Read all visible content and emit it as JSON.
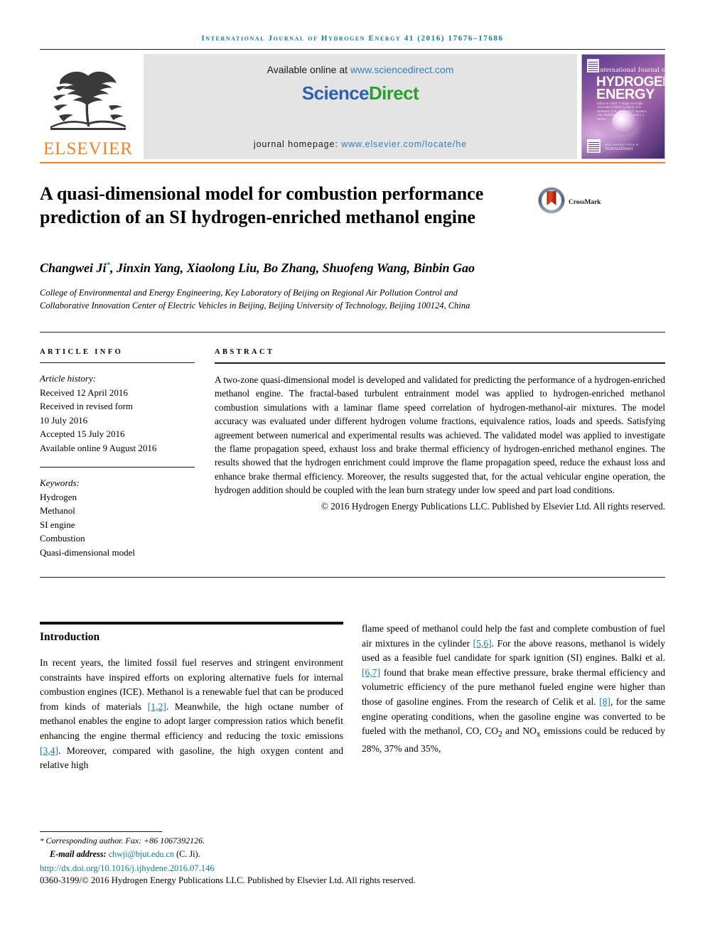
{
  "running_head": "International Journal of Hydrogen Energy 41 (2016) 17676–17686",
  "masthead": {
    "publisher_name": "ELSEVIER",
    "publisher_logo_icon": "elsevier-tree-icon",
    "available_prefix": "Available online at ",
    "available_url": "www.sciencedirect.com",
    "wordmark_first": "Science",
    "wordmark_second": "Direct",
    "homepage_prefix": "journal homepage: ",
    "homepage_url": "www.elsevier.com/locate/he",
    "cover": {
      "line1": "International Journal of",
      "line2": "HYDROGEN",
      "line3": "ENERGY",
      "editors": "Editor-in-Chief: T. Nejat Veziroğlu  Associate Editors: S. Dunn, R.C. Neuhaus, H.R. Alanis, R.C. Navarro, J.M. Bastidas, L.I. Zhu, J. and C.J. Winter",
      "bottom_brand": "ScienceDirect",
      "bottom_brand_small": "Now available online at"
    }
  },
  "article": {
    "title": "A quasi-dimensional model for combustion performance prediction of an SI hydrogen-enriched methanol engine",
    "crossmark_label": "CrossMark",
    "crossmark_icon": "crossmark-icon",
    "authors": "Changwei Ji*, Jinxin Yang, Xiaolong Liu, Bo Zhang, Shuofeng Wang, Binbin Gao",
    "authors_pre_star": "Changwei Ji",
    "authors_star": "*",
    "authors_post_star": ", Jinxin Yang, Xiaolong Liu, Bo Zhang, Shuofeng Wang, Binbin Gao",
    "affiliation": "College of Environmental and Energy Engineering, Key Laboratory of Beijing on Regional Air Pollution Control and Collaborative Innovation Center of Electric Vehicles in Beijing, Beijing University of Technology, Beijing 100124, China"
  },
  "article_info": {
    "heading": "ARTICLE INFO",
    "history_label": "Article history:",
    "history": [
      "Received 12 April 2016",
      "Received in revised form",
      "10 July 2016",
      "Accepted 15 July 2016",
      "Available online 9 August 2016"
    ],
    "keywords_label": "Keywords:",
    "keywords": [
      "Hydrogen",
      "Methanol",
      "SI engine",
      "Combustion",
      "Quasi-dimensional model"
    ]
  },
  "abstract": {
    "heading": "ABSTRACT",
    "text": "A two-zone quasi-dimensional model is developed and validated for predicting the performance of a hydrogen-enriched methanol engine. The fractal-based turbulent entrainment model was applied to hydrogen-enriched methanol combustion simulations with a laminar flame speed correlation of hydrogen-methanol-air mixtures. The model accuracy was evaluated under different hydrogen volume fractions, equivalence ratios, loads and speeds. Satisfying agreement between numerical and experimental results was achieved. The validated model was applied to investigate the flame propagation speed, exhaust loss and brake thermal efficiency of hydrogen-enriched methanol engines. The results showed that the hydrogen enrichment could improve the flame propagation speed, reduce the exhaust loss and enhance brake thermal efficiency. Moreover, the results suggested that, for the actual vehicular engine operation, the hydrogen addition should be coupled with the lean burn strategy under low speed and part load conditions.",
    "copyright": "© 2016 Hydrogen Energy Publications LLC. Published by Elsevier Ltd. All rights reserved."
  },
  "body": {
    "section_title": "Introduction",
    "left_paragraph_pre": "In recent years, the limited fossil fuel reserves and stringent environment constraints have inspired efforts on exploring alternative fuels for internal combustion engines (ICE). Methanol is a renewable fuel that can be produced from kinds of materials ",
    "ref_1_2": "[1,2]",
    "left_paragraph_mid": ". Meanwhile, the high octane number of methanol enables the engine to adopt larger compression ratios which benefit enhancing the engine thermal efficiency and reducing the toxic emissions ",
    "ref_3_4": "[3,4]",
    "left_paragraph_end": ". Moreover, compared with gasoline, the high oxygen content and relative high",
    "right_paragraph_pre": "flame speed of methanol could help the fast and complete combustion of fuel air mixtures in the cylinder ",
    "ref_5_6": "[5,6]",
    "right_paragraph_mid": ". For the above reasons, methanol is widely used as a feasible fuel candidate for spark ignition (SI) engines. Balki et al. ",
    "ref_6_7": "[6,7]",
    "right_paragraph_mid2": " found that brake mean effective pressure, brake thermal efficiency and volumetric efficiency of the pure methanol fueled engine were higher than those of gasoline engines. From the research of Celik et al. ",
    "ref_8": "[8]",
    "right_paragraph_end": ", for the same engine operating conditions, when the gasoline engine was converted to be fueled with the methanol, CO, CO",
    "right_paragraph_end2": " and NO",
    "right_paragraph_end3": " emissions could be reduced by 28%, 37% and 35%,",
    "sub_2": "2",
    "sub_x": "x"
  },
  "footer": {
    "corresponding_star": "*",
    "corresponding": " Corresponding author. Fax: +86 1067392126.",
    "email_label": "E-mail address:",
    "email": "chwji@bjut.edu.cn",
    "email_person": "(C. Ji).",
    "doi": "http://dx.doi.org/10.1016/j.ijhydene.2016.07.146",
    "issn_line": "0360-3199/© 2016 Hydrogen Energy Publications LLC. Published by Elsevier Ltd. All rights reserved."
  },
  "colors": {
    "accent_teal": "#0b7ba8",
    "elsevier_orange": "#f5821f",
    "sciencedirect_green": "#2aa02a",
    "sciencedirect_blue": "#2b62ad",
    "link_blue": "#2f7fc1"
  }
}
